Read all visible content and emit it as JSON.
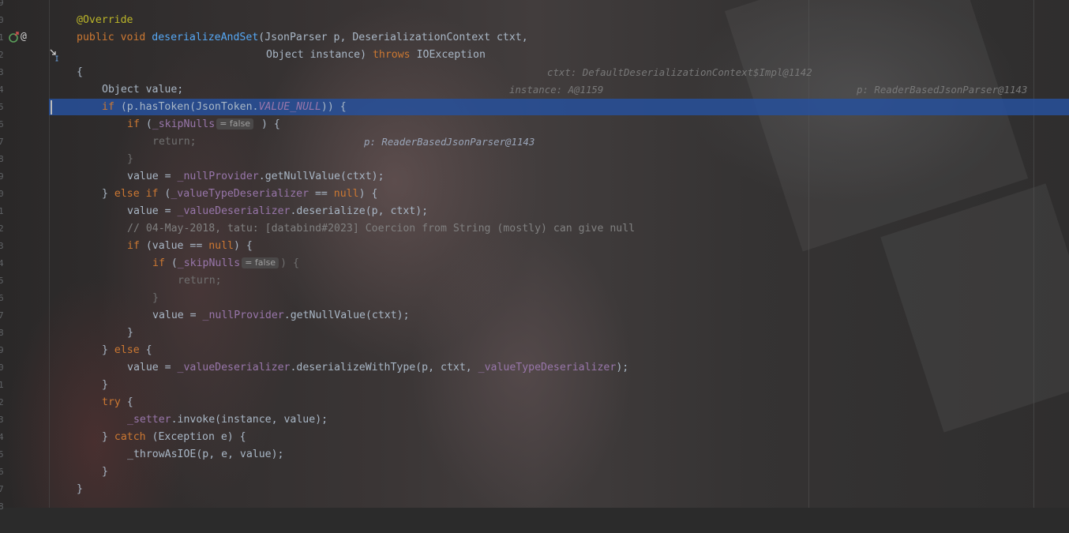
{
  "lines": [
    {
      "a": "@Override"
    },
    {
      "a": "public void ",
      "b": "deserializeAndSet",
      "c": "(JsonParser p, DeserializationContext ctxt,",
      "hint1": "ctxt: DefaultDeserializationContext$Impl@1142",
      "hint2": "p: ReaderBasedJsonParser@1143"
    },
    {
      "a": "Object instance) ",
      "b": "throws",
      "c": " IOException",
      "hint1": "instance: A@1159"
    },
    {
      "a": "{"
    },
    {
      "a": "Object value;"
    },
    {
      "a": "if",
      "b": " (p.hasToken(JsonToken.",
      "c": "VALUE_NULL",
      "d": ")) {",
      "hint1": "p: ReaderBasedJsonParser@1143"
    },
    {
      "a": "if",
      "b": " (",
      "c": "_skipNulls",
      "inlay": "= false",
      "d": " ) {"
    },
    {
      "a": "return;"
    },
    {
      "a": "}"
    },
    {
      "a": "value = ",
      "b": "_nullProvider",
      "c": ".getNullValue(ctxt);"
    },
    {
      "a": "} ",
      "b": "else if",
      "c": " (",
      "d": "_valueTypeDeserializer",
      "e": " == ",
      "f": "null",
      "g": ") {"
    },
    {
      "a": "value = ",
      "b": "_valueDeserializer",
      "c": ".deserialize(p, ctxt);"
    },
    {
      "a": "// 04-May-2018, tatu: [databind#2023] Coercion from String (mostly) can give null"
    },
    {
      "a": "if",
      "b": " (value == ",
      "c": "null",
      "d": ") {"
    },
    {
      "a": "if",
      "b": " (",
      "c": "_skipNulls",
      "inlay": "= false",
      "d": ") {"
    },
    {
      "a": "return;"
    },
    {
      "a": "}"
    },
    {
      "a": "value = ",
      "b": "_nullProvider",
      "c": ".getNullValue(ctxt);"
    },
    {
      "a": "}"
    },
    {
      "a": "} ",
      "b": "else",
      "c": " {"
    },
    {
      "a": "value = ",
      "b": "_valueDeserializer",
      "c": ".deserializeWithType(p, ctxt, ",
      "d": "_valueTypeDeserializer",
      "e": ");"
    },
    {
      "a": "}"
    },
    {
      "a": "try",
      "b": " {"
    },
    {
      "a": "_setter",
      "b": ".invoke(instance, value);"
    },
    {
      "a": "} ",
      "b": "catch",
      "c": " (Exception e) {"
    },
    {
      "a": "_throwAsIOE(p, e, value);"
    },
    {
      "a": "}"
    },
    {
      "a": "}"
    }
  ],
  "gutter": {
    "line_numbers": [
      "9",
      "0",
      "1",
      "2",
      "3",
      "4",
      "5",
      "6",
      "7",
      "8",
      "9",
      "0",
      "1",
      "2",
      "3",
      "4",
      "5",
      "6",
      "7",
      "8",
      "9",
      "0",
      "1",
      "2",
      "3",
      "4",
      "5",
      "6",
      "7",
      "8"
    ],
    "override_icon": "overriding-method-icon",
    "annotation_icon": "@",
    "cursor_icon": "mouse-pointer-icon"
  },
  "colors": {
    "keyword": "#cc7832",
    "annotation": "#bbb529",
    "method_decl": "#56a8f5",
    "field": "#9876aa",
    "comment": "#808080",
    "execution_line": "#27509b"
  }
}
